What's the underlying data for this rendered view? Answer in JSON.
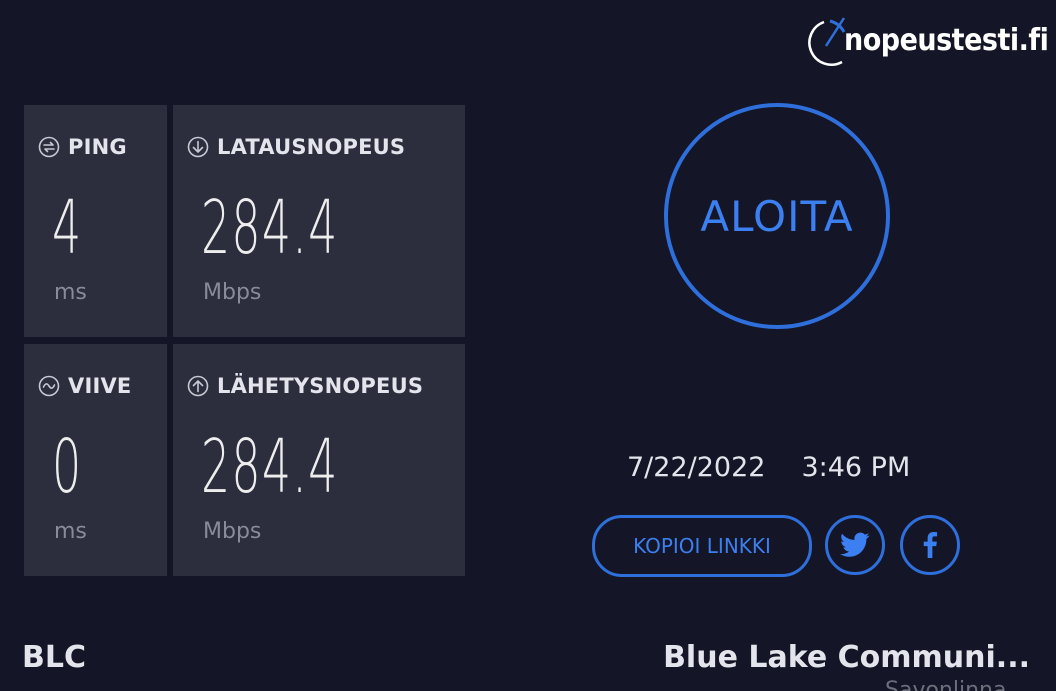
{
  "brand": {
    "logo_text": "nopeustesti.fi"
  },
  "tiles": {
    "ping": {
      "label": "PING",
      "value": "4",
      "unit": "ms",
      "icon": "ping-icon"
    },
    "download": {
      "label": "LATAUSNOPEUS",
      "value": "284.4",
      "unit": "Mbps",
      "icon": "download-arrow-icon"
    },
    "jitter": {
      "label": "VIIVE",
      "value": "0",
      "unit": "ms",
      "icon": "wave-icon"
    },
    "upload": {
      "label": "LÄHETYSNOPEUS",
      "value": "284.4",
      "unit": "Mbps",
      "icon": "upload-arrow-icon"
    }
  },
  "start_button": {
    "label": "ALOITA"
  },
  "result": {
    "date": "7/22/2022",
    "time": "3:46 PM"
  },
  "share": {
    "copy_link_label": "KOPIOI LINKKI",
    "twitter_icon": "twitter-icon",
    "facebook_icon": "facebook-icon"
  },
  "provider": {
    "short_name": "BLC",
    "long_name": "Blue Lake Communi...",
    "city": "Savonlinna"
  },
  "colors": {
    "background": "#141526",
    "tile": "#2c2d3d",
    "accent": "#2f6fdc",
    "accent_text": "#3b7ff0"
  }
}
